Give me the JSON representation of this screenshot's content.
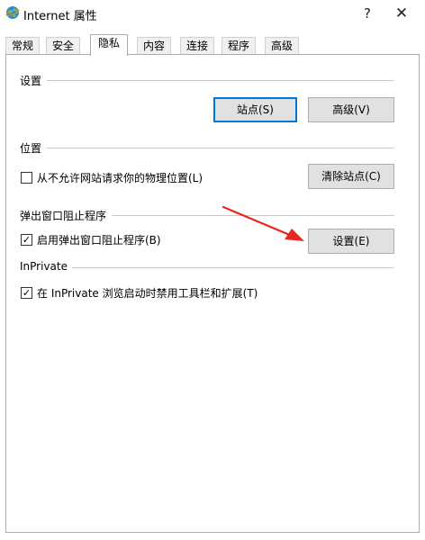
{
  "window": {
    "title": "Internet 属性",
    "help_glyph": "?",
    "close_glyph": "✕"
  },
  "tabs": [
    {
      "label": "常规",
      "active": false
    },
    {
      "label": "安全",
      "active": false
    },
    {
      "label": "隐私",
      "active": true
    },
    {
      "label": "内容",
      "active": false
    },
    {
      "label": "连接",
      "active": false
    },
    {
      "label": "程序",
      "active": false
    },
    {
      "label": "高级",
      "active": false
    }
  ],
  "settings": {
    "heading": "设置",
    "sites_button": "站点(S)",
    "advanced_button": "高级(V)"
  },
  "location": {
    "heading": "位置",
    "checkbox_label": "从不允许网站请求你的物理位置(L)",
    "checked": false,
    "clear_button": "清除站点(C)"
  },
  "popup": {
    "heading": "弹出窗口阻止程序",
    "checkbox_label": "启用弹出窗口阻止程序(B)",
    "checked": true,
    "settings_button": "设置(E)"
  },
  "inprivate": {
    "heading": "InPrivate",
    "checkbox_label": "在 InPrivate 浏览启动时禁用工具栏和扩展(T)",
    "checked": true
  },
  "colors": {
    "accent": "#0078d7",
    "annotation_arrow": "#e8251f"
  },
  "icons": {
    "app": "internet-options-globe-icon",
    "check": "✓"
  }
}
